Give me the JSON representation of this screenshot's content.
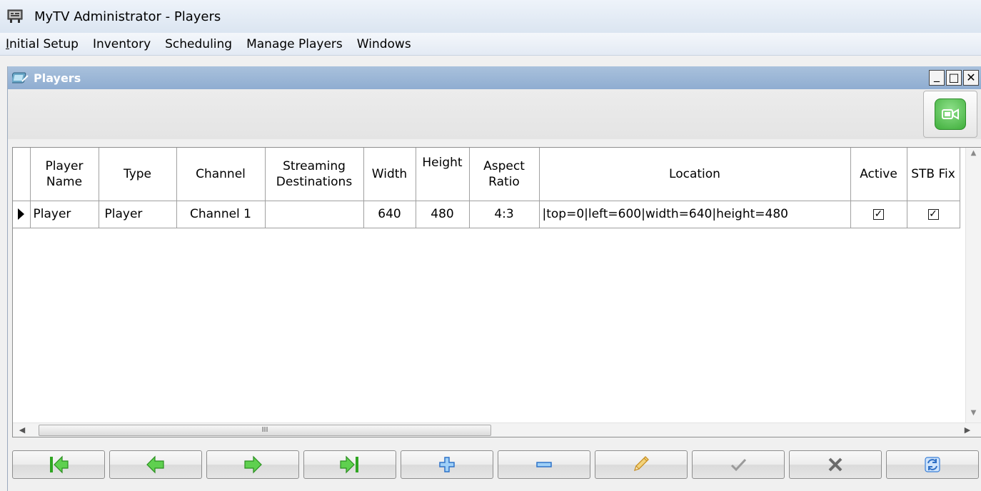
{
  "window": {
    "title": "MyTV Administrator - Players"
  },
  "menu": [
    {
      "mnemonic": "I",
      "rest": "nitial Setup"
    },
    {
      "mnemonic": "",
      "rest": "Inventory"
    },
    {
      "mnemonic": "",
      "rest": "Scheduling"
    },
    {
      "mnemonic": "",
      "rest": "Manage Players"
    },
    {
      "mnemonic": "",
      "rest": "Windows"
    }
  ],
  "child_window": {
    "title": "Players",
    "buttons": {
      "minimize": "_",
      "maximize": "□",
      "close": "✕"
    }
  },
  "grid": {
    "columns": [
      {
        "line1": "Player",
        "line2": "Name"
      },
      {
        "line1": "Type",
        "line2": ""
      },
      {
        "line1": "Channel",
        "line2": ""
      },
      {
        "line1": "Streaming",
        "line2": "Destinations"
      },
      {
        "line1": "Width",
        "line2": ""
      },
      {
        "line1": "Height",
        "line2": ""
      },
      {
        "line1": "Aspect",
        "line2": "Ratio"
      },
      {
        "line1": "Location",
        "line2": ""
      },
      {
        "line1": "Active",
        "line2": ""
      },
      {
        "line1": "STB Fix",
        "line2": ""
      }
    ],
    "rows": [
      {
        "player_name": "Player",
        "type": "Player",
        "channel": "Channel 1",
        "streaming_destinations": "",
        "width": "640",
        "height": "480",
        "aspect_ratio": "4:3",
        "location": "|top=0|left=600|width=640|height=480",
        "active": "☑",
        "stb_fix": "☑"
      }
    ],
    "hscroll_grip": "III"
  },
  "navigator": [
    {
      "name": "first-record-button",
      "icon": "first-icon"
    },
    {
      "name": "prior-record-button",
      "icon": "prior-icon"
    },
    {
      "name": "next-record-button",
      "icon": "next-icon"
    },
    {
      "name": "last-record-button",
      "icon": "last-icon"
    },
    {
      "name": "insert-record-button",
      "icon": "plus-icon"
    },
    {
      "name": "delete-record-button",
      "icon": "minus-icon"
    },
    {
      "name": "edit-record-button",
      "icon": "pencil-icon"
    },
    {
      "name": "post-edit-button",
      "icon": "checkmark-icon"
    },
    {
      "name": "cancel-edit-button",
      "icon": "x-icon"
    },
    {
      "name": "refresh-data-button",
      "icon": "refresh-icon"
    }
  ],
  "colors": {
    "nav_green": "#3dbd2e",
    "nav_blue": "#3a7fd8",
    "child_title_bg": "#9bb7d8"
  }
}
